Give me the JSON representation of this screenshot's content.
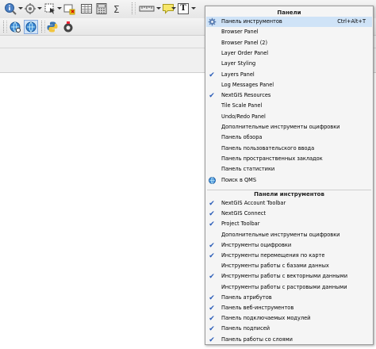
{
  "colors": {
    "check": "#2a5cb8",
    "highlight": "#cfe3f7",
    "menu_bg": "#f5f5f5"
  },
  "toolbar": {
    "row1_icons": [
      "identify-icon",
      "pan-map-icon",
      "select-features-icon",
      "deselect-icon",
      "open-attribute-table-icon",
      "field-calculator-icon",
      "statistics-icon",
      "measure-icon",
      "annotation-icon",
      "text-annotation-icon"
    ],
    "row2_icons": [
      "qms-search-icon",
      "qms-web-icon",
      "python-console-icon",
      "plugin-icon"
    ],
    "text_annotation_label": "T"
  },
  "panels_section": {
    "title": "Панели",
    "items": [
      {
        "label": "Панель инструментов",
        "shortcut": "Ctrl+Alt+T",
        "checked": false,
        "icon": "gear-icon",
        "highlighted": true
      },
      {
        "label": "Browser Panel",
        "checked": false
      },
      {
        "label": "Browser Panel (2)",
        "checked": false
      },
      {
        "label": "Layer Order Panel",
        "checked": false
      },
      {
        "label": "Layer Styling",
        "checked": false
      },
      {
        "label": "Layers Panel",
        "checked": true
      },
      {
        "label": "Log Messages Panel",
        "checked": false
      },
      {
        "label": "NextGIS Resources",
        "checked": true
      },
      {
        "label": "Tile Scale Panel",
        "checked": false
      },
      {
        "label": "Undo/Redo Panel",
        "checked": false
      },
      {
        "label": "Дополнительные инструменты оцифровки",
        "checked": false
      },
      {
        "label": "Панель обзора",
        "checked": false
      },
      {
        "label": "Панель пользовательского ввода",
        "checked": false
      },
      {
        "label": "Панель пространственных закладок",
        "checked": false
      },
      {
        "label": "Панель статистики",
        "checked": false
      },
      {
        "label": "Поиск в QMS",
        "checked": false,
        "icon": "qms-search-icon"
      }
    ]
  },
  "toolbars_section": {
    "title": "Панели инструментов",
    "items": [
      {
        "label": "NextGIS Account Toolbar",
        "checked": true
      },
      {
        "label": "NextGIS Connect",
        "checked": true
      },
      {
        "label": "Project Toolbar",
        "checked": true
      },
      {
        "label": "Дополнительные инструменты оцифровки",
        "checked": false
      },
      {
        "label": "Инструменты оцифровки",
        "checked": true
      },
      {
        "label": "Инструменты перемещения по карте",
        "checked": true
      },
      {
        "label": "Инструменты работы с базами данных",
        "checked": false
      },
      {
        "label": "Инструменты работы с векторными данными",
        "checked": true
      },
      {
        "label": "Инструменты работы с растровыми данными",
        "checked": false
      },
      {
        "label": "Панель атрибутов",
        "checked": true
      },
      {
        "label": "Панель веб-инструментов",
        "checked": true
      },
      {
        "label": "Панель подключаемых модулей",
        "checked": true
      },
      {
        "label": "Панель подписей",
        "checked": true
      },
      {
        "label": "Панель работы со слоями",
        "checked": true
      }
    ]
  }
}
